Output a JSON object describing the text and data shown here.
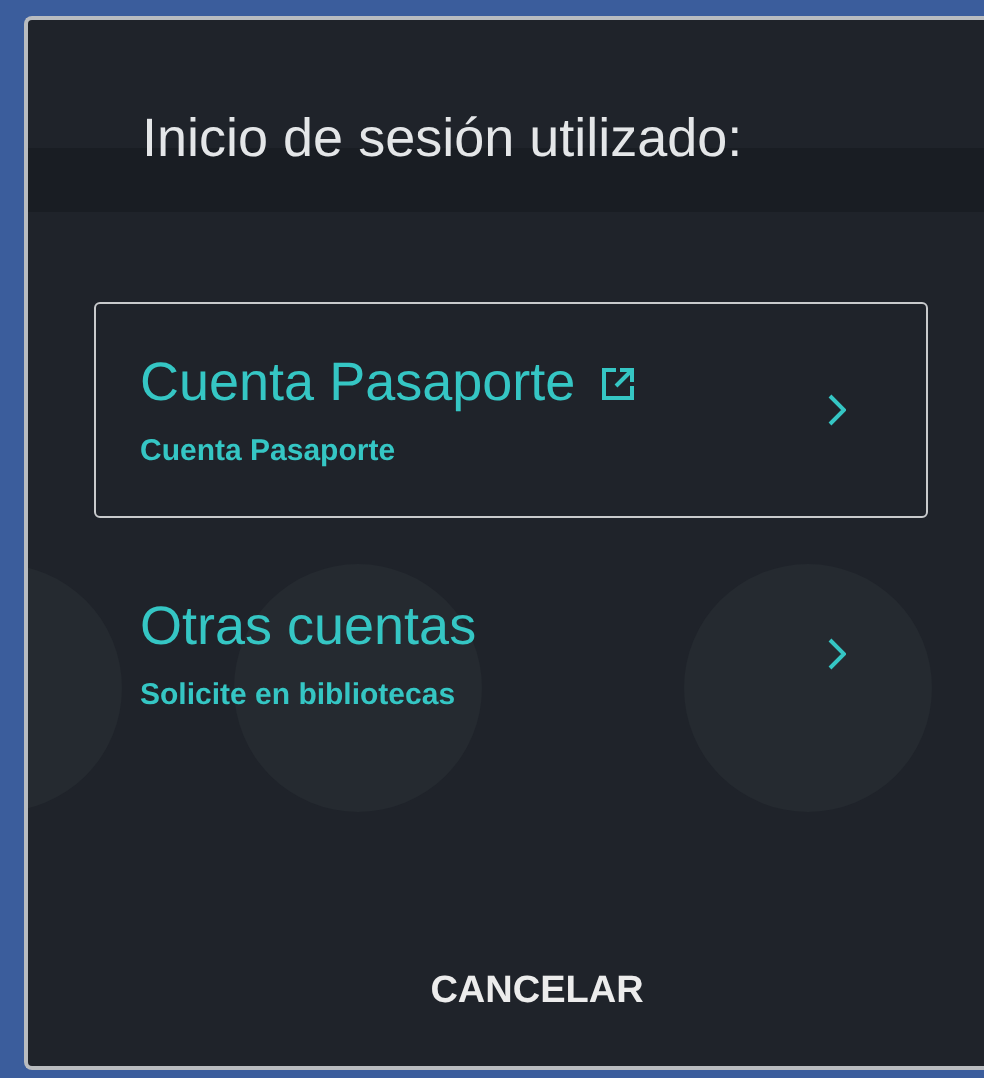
{
  "dialog": {
    "title": "Inicio de sesión utilizado:",
    "options": [
      {
        "title": "Cuenta Pasaporte",
        "subtitle": "Cuenta Pasaporte",
        "external_link": true,
        "selected": true
      },
      {
        "title": "Otras cuentas",
        "subtitle": "Solicite en bibliotecas",
        "external_link": false,
        "selected": false
      }
    ],
    "cancel_button": "CANCELAR"
  }
}
